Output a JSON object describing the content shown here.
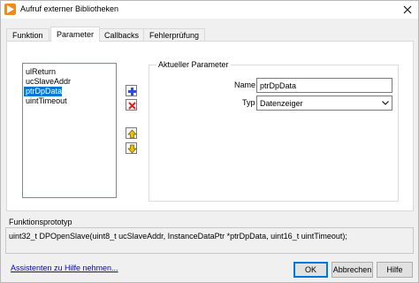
{
  "window": {
    "title": "Aufruf externer Bibliotheken",
    "app_icon": "run-arrow-icon",
    "close_icon": "close-icon"
  },
  "tabs": [
    {
      "label": "Funktion",
      "active": false
    },
    {
      "label": "Parameter",
      "active": true
    },
    {
      "label": "Callbacks",
      "active": false
    },
    {
      "label": "Fehlerprüfung",
      "active": false
    }
  ],
  "parameters": {
    "items": [
      "ulReturn",
      "ucSlaveAddr",
      "ptrDpData",
      "uintTimeout"
    ],
    "selected": "ptrDpData"
  },
  "side_buttons": {
    "add_icon": "plus-icon",
    "delete_icon": "delete-x-icon",
    "move_up_icon": "arrow-up-icon",
    "move_down_icon": "arrow-down-icon"
  },
  "current_parameter": {
    "title": "Aktueller Parameter",
    "name_label": "Name",
    "name_value": "ptrDpData",
    "type_label": "Typ",
    "type_value": "Datenzeiger"
  },
  "prototype": {
    "label": "Funktionsprototyp",
    "text": "uint32_t DPOpenSlave(uint8_t ucSlaveAddr, InstanceDataPtr *ptrDpData, uint16_t uintTimeout);"
  },
  "footer": {
    "help_link": "Assistenten zu Hilfe nehmen...",
    "ok": "OK",
    "cancel": "Abbrechen",
    "help": "Hilfe"
  },
  "colors": {
    "accent": "#0078d7",
    "app_icon": "#f08a1c",
    "add_icon": "#2b4fd8",
    "delete_icon": "#e02020",
    "arrow_icons": "#e8c200"
  }
}
